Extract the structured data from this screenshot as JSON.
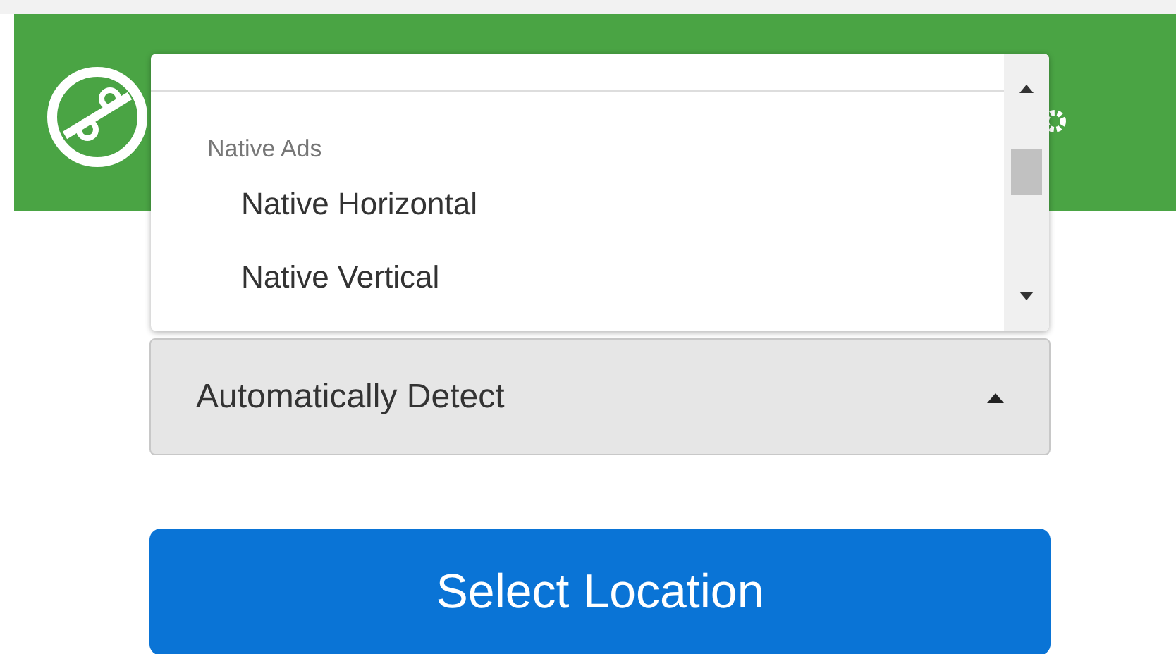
{
  "dropdown": {
    "group": "Native Ads",
    "expanded": true,
    "options": [
      {
        "label": "Native Horizontal",
        "selected": false
      },
      {
        "label": "Native Vertical",
        "selected": false
      }
    ]
  },
  "select": {
    "value": "Automatically Detect"
  },
  "button": {
    "label": "Select Location"
  }
}
